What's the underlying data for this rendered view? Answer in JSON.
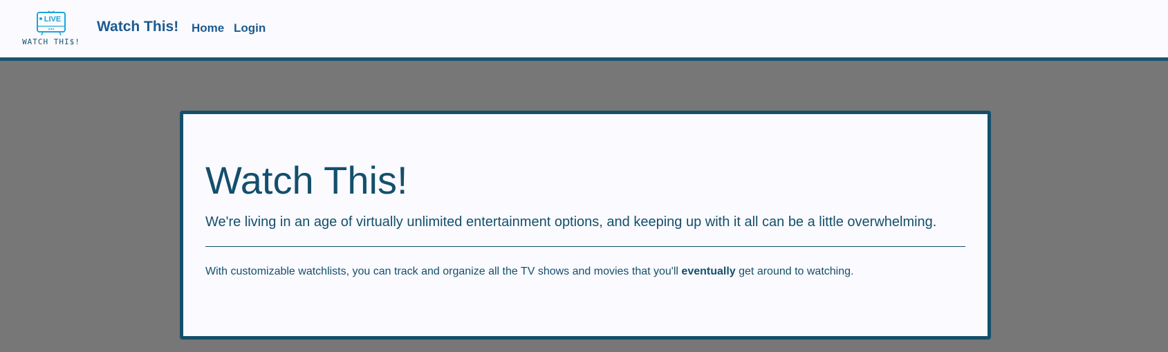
{
  "navbar": {
    "logo": {
      "badge_text": "LIVE",
      "caption": "WATCH THI$!",
      "icon": "live-tv-icon",
      "color": "#1aa6d9"
    },
    "brand": "Watch This!",
    "links": [
      {
        "label": "Home"
      },
      {
        "label": "Login"
      }
    ]
  },
  "hero": {
    "title": "Watch This!",
    "lead": "We're living in an age of virtually unlimited entertainment options, and keeping up with it all can be a little overwhelming.",
    "body_before": "With customizable watchlists, you can track and organize all the TV shows and movies that you'll ",
    "body_emphasis": "eventually",
    "body_after": " get around to watching."
  },
  "colors": {
    "page_background": "#777777",
    "surface": "#fafaff",
    "primary": "#144f6b",
    "link": "#1d5a8f",
    "logo_accent": "#1aa6d9"
  }
}
